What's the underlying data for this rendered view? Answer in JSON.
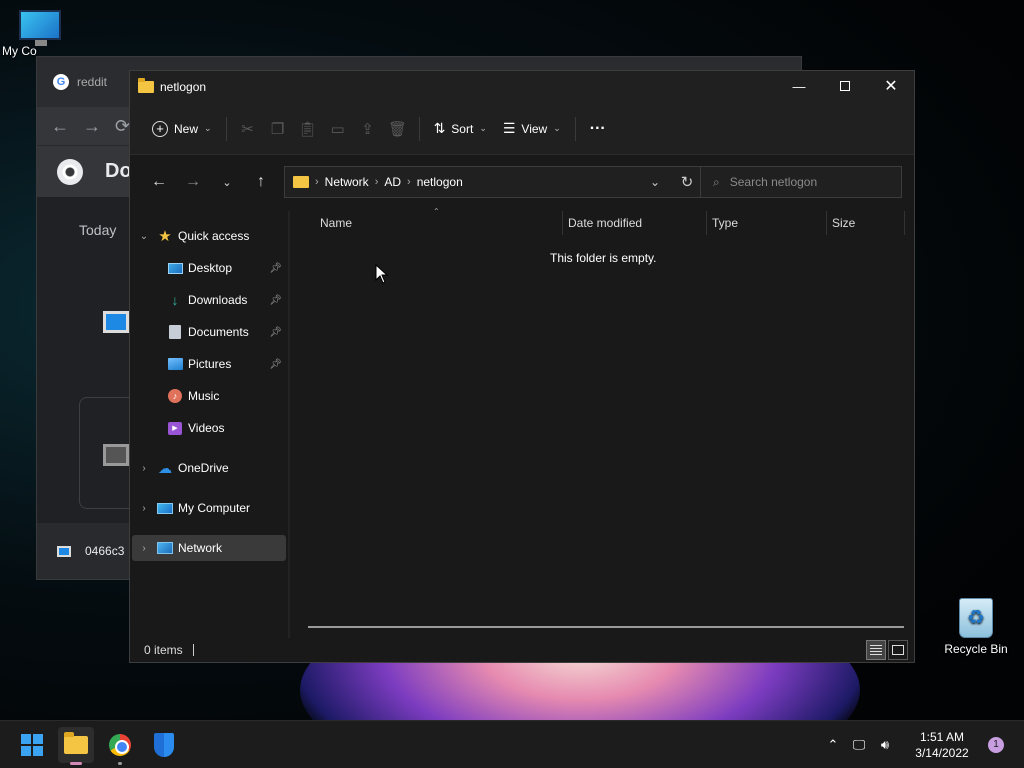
{
  "desktop": {
    "icons": [
      {
        "label": "My Co",
        "icon": "computer-icon"
      },
      {
        "label": "Recycle Bin",
        "icon": "recycle-bin-icon"
      }
    ]
  },
  "background_chrome": {
    "tab_title": "reddit",
    "page_heading": "Do",
    "today_label": "Today",
    "download_file": "0466c3"
  },
  "explorer": {
    "title": "netlogon",
    "commandbar": {
      "new_label": "New",
      "sort_label": "Sort",
      "view_label": "View",
      "more_label": "···"
    },
    "breadcrumb": [
      "Network",
      "AD",
      "netlogon"
    ],
    "search_placeholder": "Search netlogon",
    "navpane": {
      "quick_access": "Quick access",
      "pinned": [
        {
          "label": "Desktop",
          "icon": "desktop-icon",
          "pinned": true
        },
        {
          "label": "Downloads",
          "icon": "downloads-icon",
          "pinned": true
        },
        {
          "label": "Documents",
          "icon": "documents-icon",
          "pinned": true
        },
        {
          "label": "Pictures",
          "icon": "pictures-icon",
          "pinned": true
        },
        {
          "label": "Music",
          "icon": "music-icon",
          "pinned": false
        },
        {
          "label": "Videos",
          "icon": "videos-icon",
          "pinned": false
        }
      ],
      "onedrive": "OneDrive",
      "my_computer": "My Computer",
      "network": "Network",
      "selected": "Network"
    },
    "columns": [
      "Name",
      "Date modified",
      "Type",
      "Size"
    ],
    "empty_message": "This folder is empty.",
    "status_text": "0 items"
  },
  "taskbar": {
    "apps": [
      "start-icon",
      "file-explorer-icon",
      "chrome-icon",
      "defender-icon"
    ],
    "time": "1:51 AM",
    "date": "3/14/2022",
    "notification_count": "1"
  },
  "colors": {
    "accent": "#3aa3f2",
    "folder": "#f4c542",
    "window_bg": "#191919",
    "selected_bg": "#3a3a3a"
  }
}
